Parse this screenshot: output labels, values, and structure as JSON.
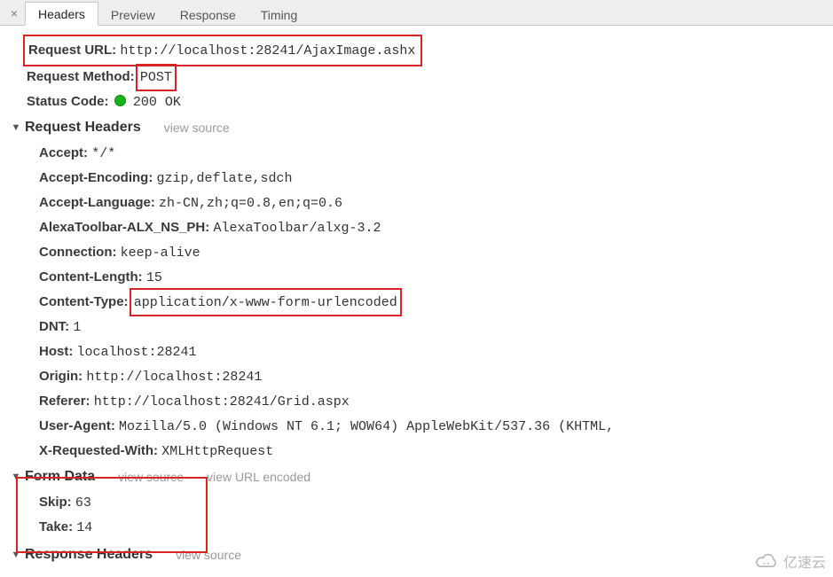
{
  "tabs": {
    "close": "×",
    "headers": "Headers",
    "preview": "Preview",
    "response": "Response",
    "timing": "Timing"
  },
  "general": {
    "request_url_label": "Request URL:",
    "request_url_value": "http://localhost:28241/AjaxImage.ashx",
    "request_method_label": "Request Method:",
    "request_method_value": "POST",
    "status_code_label": "Status Code:",
    "status_code_value": "200 OK"
  },
  "request_headers": {
    "title": "Request Headers",
    "view_source": "view source",
    "items": [
      {
        "k": "Accept:",
        "v": "*/*"
      },
      {
        "k": "Accept-Encoding:",
        "v": "gzip,deflate,sdch"
      },
      {
        "k": "Accept-Language:",
        "v": "zh-CN,zh;q=0.8,en;q=0.6"
      },
      {
        "k": "AlexaToolbar-ALX_NS_PH:",
        "v": "AlexaToolbar/alxg-3.2"
      },
      {
        "k": "Connection:",
        "v": "keep-alive"
      },
      {
        "k": "Content-Length:",
        "v": "15"
      },
      {
        "k": "Content-Type:",
        "v": "application/x-www-form-urlencoded"
      },
      {
        "k": "DNT:",
        "v": "1"
      },
      {
        "k": "Host:",
        "v": "localhost:28241"
      },
      {
        "k": "Origin:",
        "v": "http://localhost:28241"
      },
      {
        "k": "Referer:",
        "v": "http://localhost:28241/Grid.aspx"
      },
      {
        "k": "User-Agent:",
        "v": "Mozilla/5.0 (Windows NT 6.1; WOW64) AppleWebKit/537.36 (KHTML,"
      },
      {
        "k": "X-Requested-With:",
        "v": "XMLHttpRequest"
      }
    ]
  },
  "form_data": {
    "title": "Form Data",
    "view_source": "view source",
    "view_url_encoded": "view URL encoded",
    "items": [
      {
        "k": "Skip:",
        "v": "63"
      },
      {
        "k": "Take:",
        "v": "14"
      }
    ]
  },
  "response_headers": {
    "title": "Response Headers",
    "view_source": "view source"
  },
  "watermark": "亿速云"
}
